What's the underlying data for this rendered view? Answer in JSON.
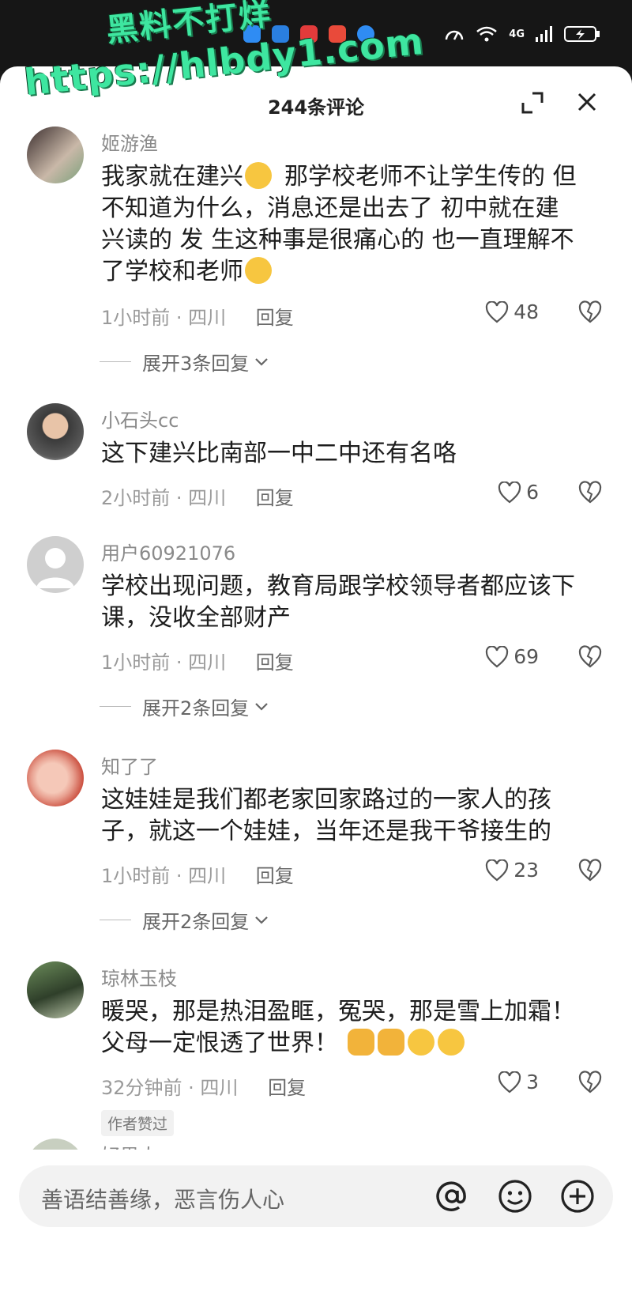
{
  "watermark": {
    "line1": "黑料不打烊",
    "line2": "https://hlbdy1.com"
  },
  "status": {
    "network": "4G"
  },
  "header": {
    "title": "244条评论"
  },
  "comments": [
    {
      "name": "姬游渔",
      "text_lines": [
        "我家就在建兴",
        "那学校老师不让学生传的 但",
        "不知道为什么，消息还是出去了  初中就在建",
        "兴读的  发 生这种事是很痛心的  也一直理解不",
        "了学校和老师"
      ],
      "time": "1小时前 · 四川",
      "reply": "回复",
      "likes": "48",
      "expand": "展开3条回复"
    },
    {
      "name": "小石头cc",
      "text_lines": [
        "这下建兴比南部一中二中还有名咯"
      ],
      "time": "2小时前 · 四川",
      "reply": "回复",
      "likes": "6"
    },
    {
      "name": "用户60921076",
      "text_lines": [
        "学校出现问题，教育局跟学校领导者都应该下",
        "课，没收全部财产"
      ],
      "time": "1小时前 · 四川",
      "reply": "回复",
      "likes": "69",
      "expand": "展开2条回复"
    },
    {
      "name": "知了了",
      "text_lines": [
        "这娃娃是我们都老家回家路过的一家人的孩",
        "子，就这一个娃娃，当年还是我干爷接生的"
      ],
      "time": "1小时前 · 四川",
      "reply": "回复",
      "likes": "23",
      "expand": "展开2条回复"
    },
    {
      "name": "琼林玉枝",
      "text_lines": [
        "暖哭，那是热泪盈眶，冤哭，那是雪上加霜！",
        "父母一定恨透了世界！"
      ],
      "time": "32分钟前 · 四川",
      "reply": "回复",
      "likes": "3",
      "badge": "作者赞过"
    }
  ],
  "next_name_partial": "好男人",
  "input": {
    "placeholder": "善语结善缘，恶言伤人心"
  }
}
